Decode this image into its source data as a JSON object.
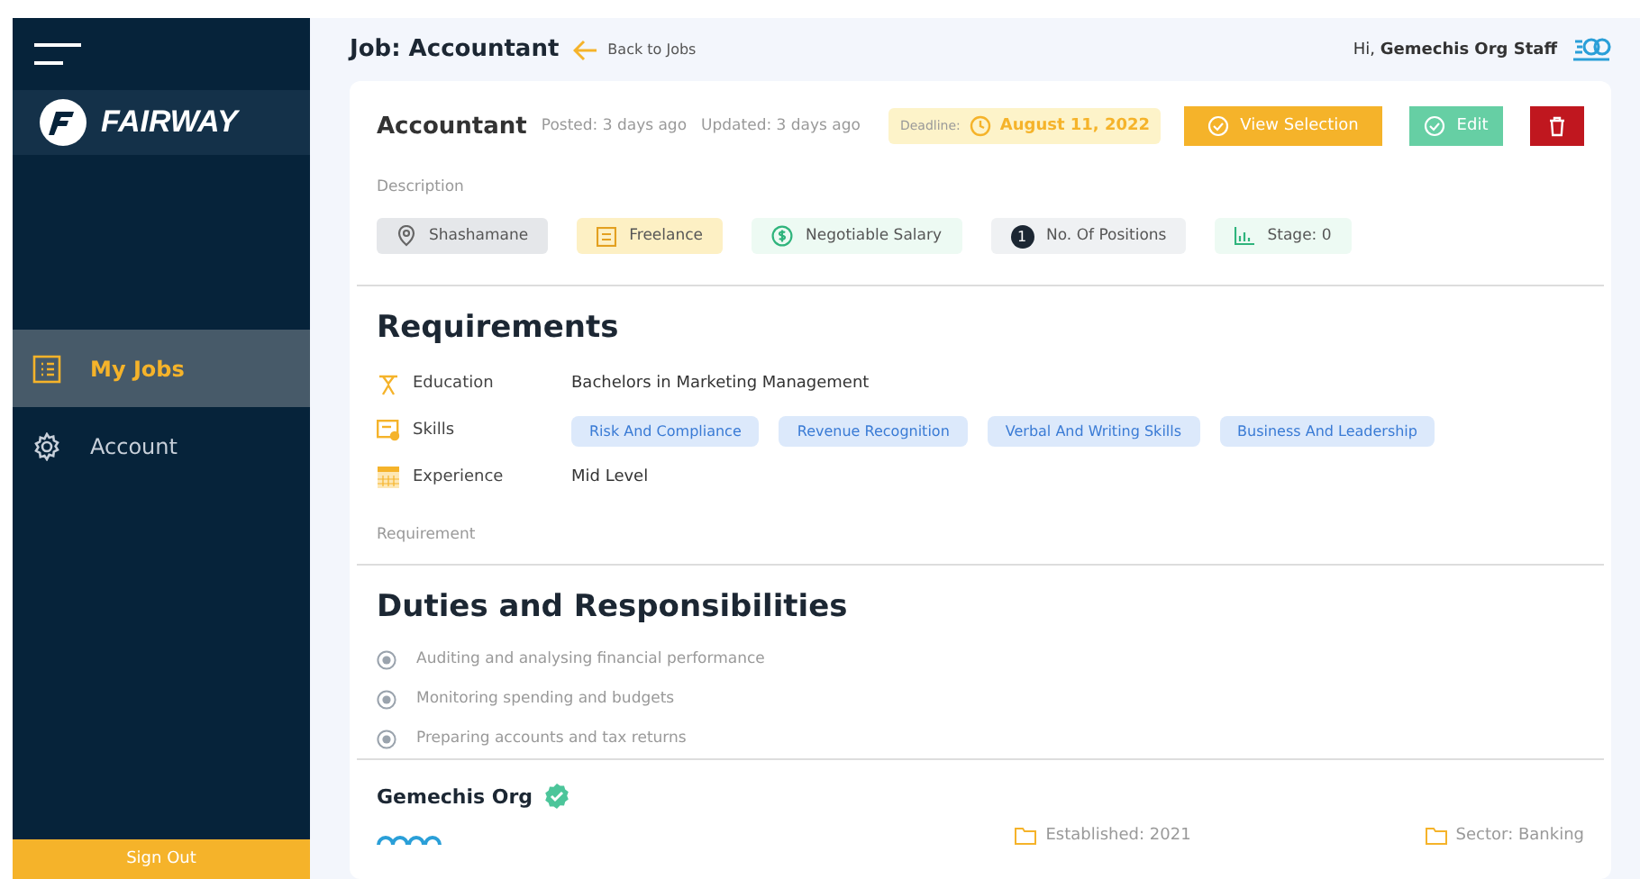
{
  "sidebar": {
    "brand": "FAIRWAY",
    "items": [
      {
        "label": "My Jobs",
        "kind": "jobs",
        "selected": true
      },
      {
        "label": "Account",
        "kind": "account",
        "selected": false
      }
    ],
    "sign_out": "Sign Out"
  },
  "header": {
    "title": "Job: Accountant",
    "back_link": "Back to Jobs",
    "greeting": "Hi,",
    "user": "Gemechis Org Staff"
  },
  "job": {
    "title": "Accountant",
    "posted": "Posted: 3 days ago",
    "updated": "Updated: 3 days ago",
    "deadline_label": "Deadline:",
    "deadline": "August 11, 2022",
    "buttons": {
      "view_selection": "View Selection",
      "edit": "Edit"
    },
    "description_label": "Description",
    "tags": [
      {
        "kind": "location",
        "label": "Shashamane"
      },
      {
        "kind": "type",
        "label": "Freelance"
      },
      {
        "kind": "salary",
        "label": "Negotiable Salary"
      },
      {
        "kind": "positions",
        "count": "1",
        "label": "No. Of Positions"
      },
      {
        "kind": "stage",
        "label": "Stage: 0"
      }
    ]
  },
  "requirements": {
    "title": "Requirements",
    "rows": [
      {
        "kind": "education",
        "label": "Education",
        "value": "Bachelors in Marketing Management"
      },
      {
        "kind": "skills",
        "label": "Skills",
        "skills": [
          "Risk And Compliance",
          "Revenue Recognition",
          "Verbal And Writing Skills",
          "Business And Leadership"
        ]
      },
      {
        "kind": "experience",
        "label": "Experience",
        "value": "Mid Level"
      }
    ],
    "footer_label": "Requirement"
  },
  "duties": {
    "title": "Duties and Responsibilities",
    "items": [
      "Auditing and analysing financial performance",
      "Monitoring spending and budgets",
      "Preparing accounts and tax returns"
    ]
  },
  "organization": {
    "name": "Gemechis Org",
    "verified": true,
    "established": "Established: 2021",
    "sector": "Sector: Banking"
  }
}
